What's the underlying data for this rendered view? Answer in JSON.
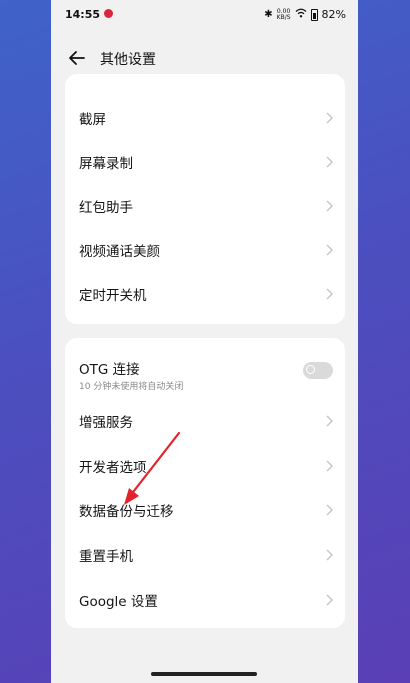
{
  "status_bar": {
    "time": "14:55",
    "icons": [
      "notification-icon",
      "bluetooth-icon",
      "wifi-icon",
      "battery-icon"
    ],
    "net_speed": "0.00\nKB/S",
    "battery": "82%"
  },
  "header": {
    "title": "其他设置",
    "back_icon": "arrow-left-icon"
  },
  "card1": {
    "peek_label": "",
    "items": [
      {
        "label": "截屏"
      },
      {
        "label": "屏幕录制"
      },
      {
        "label": "红包助手"
      },
      {
        "label": "视频通话美颜"
      },
      {
        "label": "定时开关机"
      }
    ]
  },
  "card2": {
    "otg": {
      "label": "OTG 连接",
      "sublabel": "10 分钟未使用将自动关闭",
      "enabled": false
    },
    "items": [
      {
        "label": "增强服务"
      },
      {
        "label": "开发者选项"
      },
      {
        "label": "数据备份与迁移"
      },
      {
        "label": "重置手机"
      },
      {
        "label": "Google 设置"
      }
    ]
  },
  "colors": {
    "annotation_arrow": "#e3222b",
    "background_gradient_start": "#3f63c9",
    "background_gradient_end": "#5a3fb6"
  }
}
